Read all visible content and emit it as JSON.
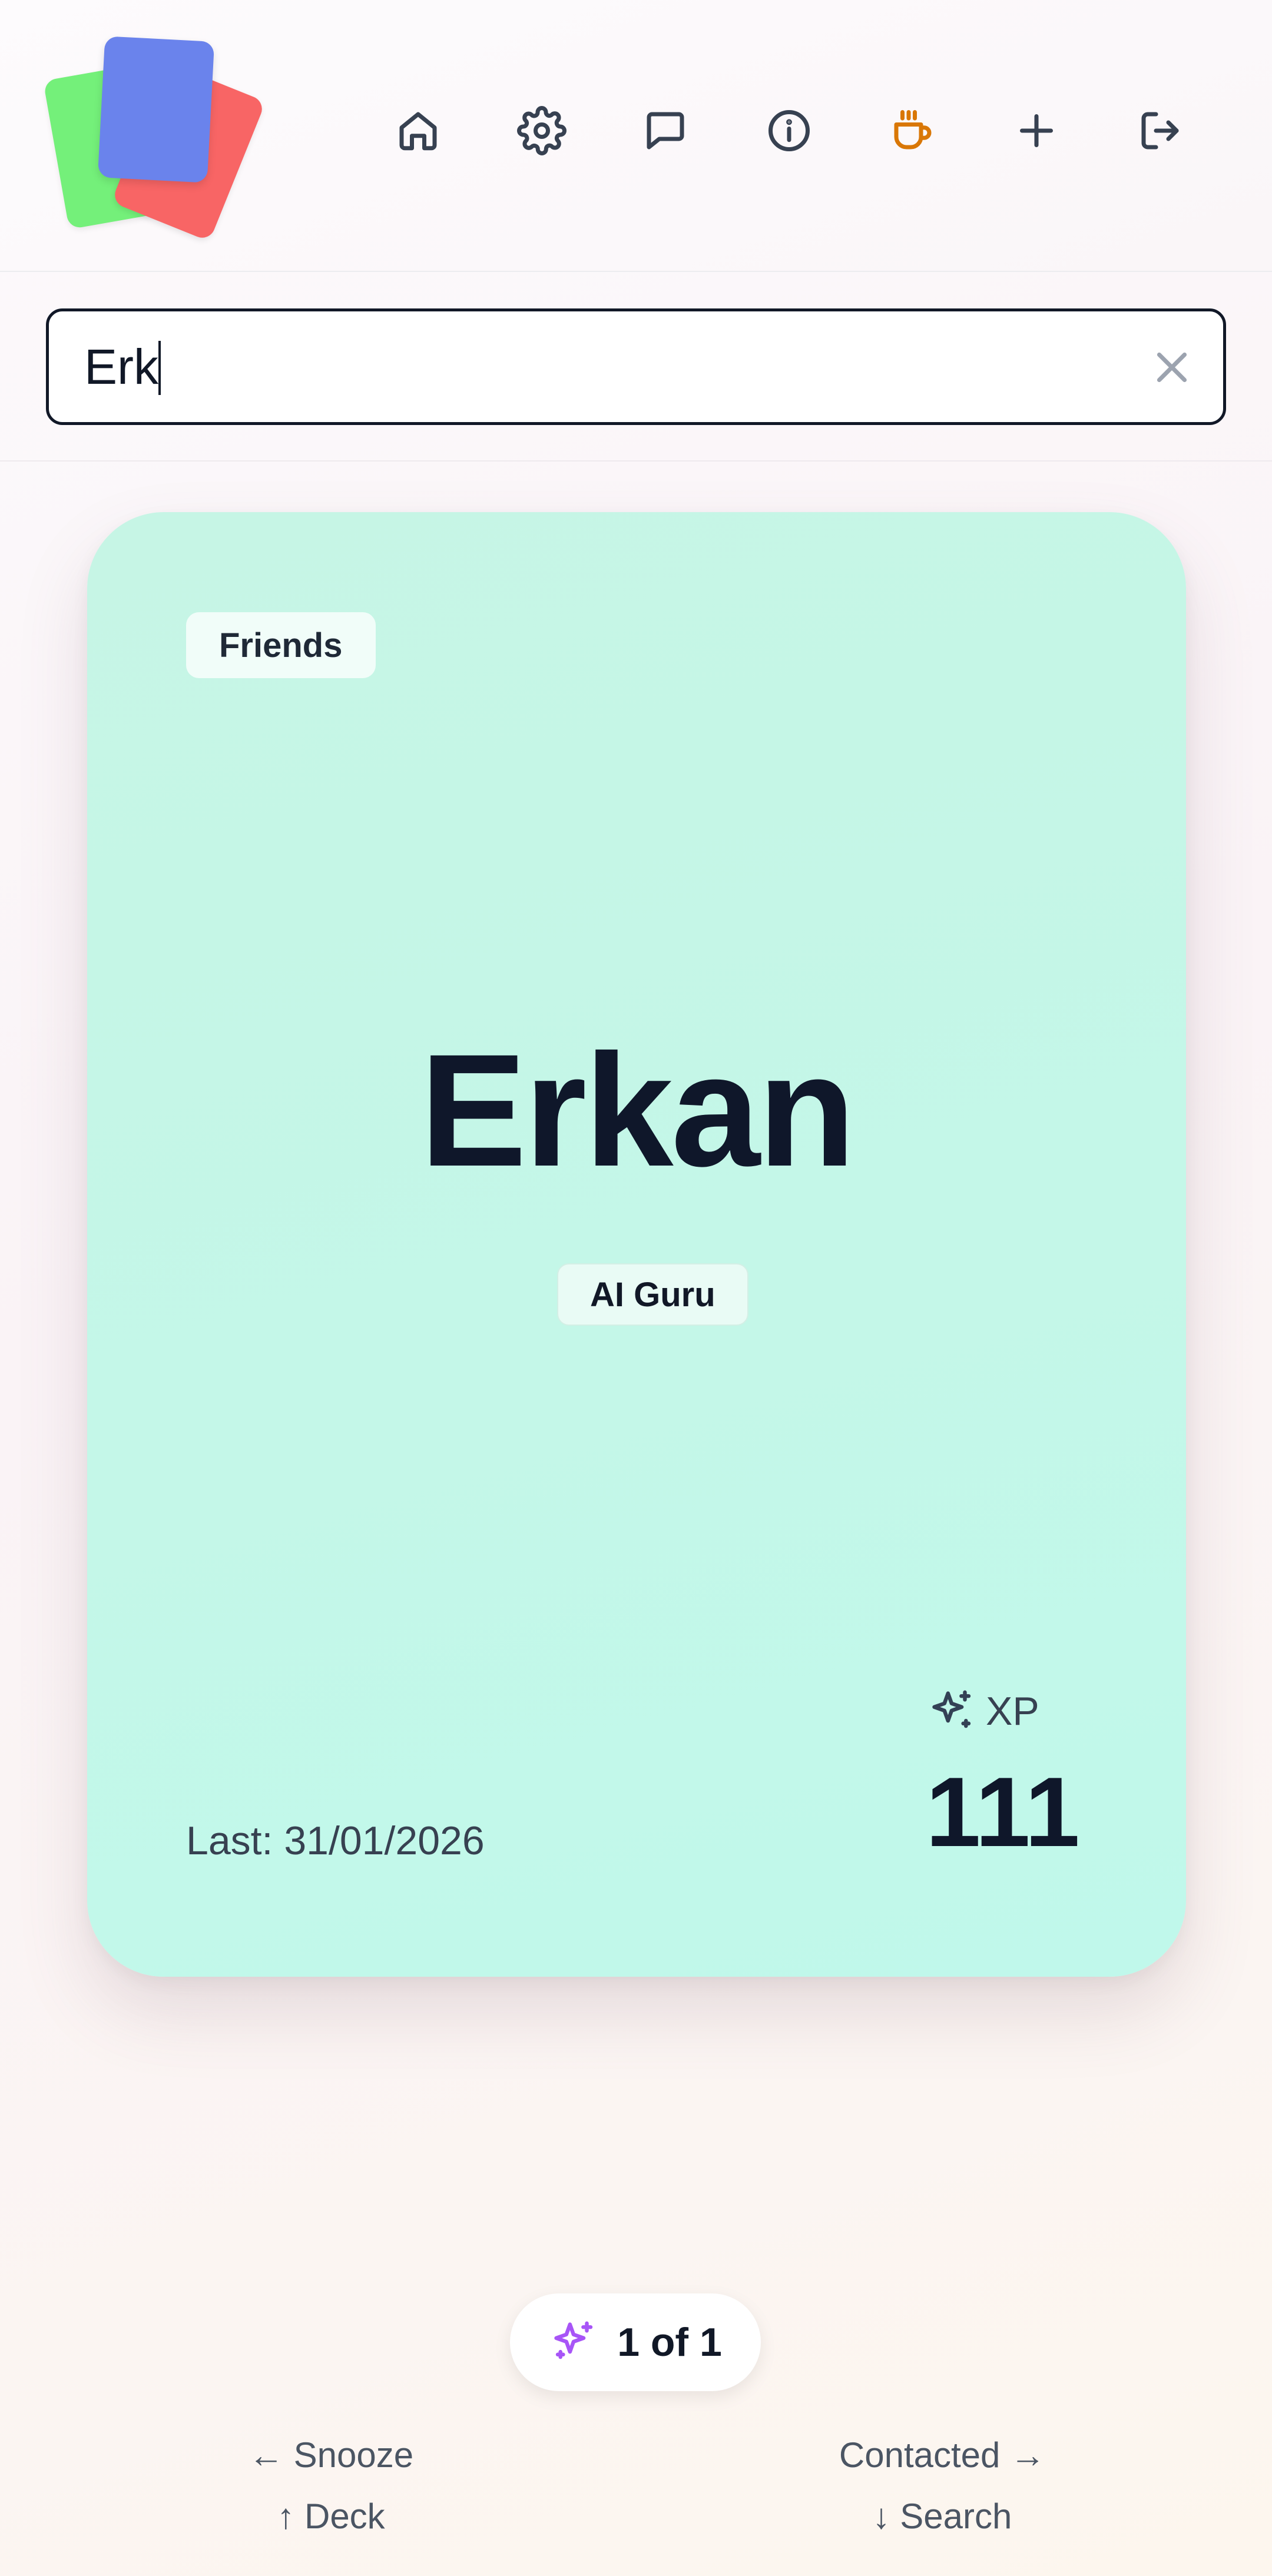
{
  "header": {
    "logo": "stacked-cards-logo",
    "nav": [
      {
        "name": "home-button",
        "icon": "home-icon"
      },
      {
        "name": "settings-button",
        "icon": "gear-icon"
      },
      {
        "name": "messages-button",
        "icon": "chat-bubble-icon"
      },
      {
        "name": "info-button",
        "icon": "info-icon"
      },
      {
        "name": "coffee-button",
        "icon": "coffee-cup-icon",
        "color": "#d97706"
      },
      {
        "name": "add-button",
        "icon": "plus-icon"
      },
      {
        "name": "logout-button",
        "icon": "logout-icon"
      }
    ]
  },
  "search": {
    "value": "Erk",
    "clear_icon": "close-icon"
  },
  "card": {
    "group": "Friends",
    "name": "Erkan",
    "role": "AI Guru",
    "last_contact": "Last: 31/01/2026",
    "xp_label": "XP",
    "xp_value": "111",
    "background": "#c4f7e8"
  },
  "counter": {
    "text": "1 of 1",
    "icon": "sparkles-icon"
  },
  "hints": {
    "left": "← Snooze",
    "right": "Contacted →",
    "up": "↑ Deck",
    "down": "↓ Search"
  }
}
